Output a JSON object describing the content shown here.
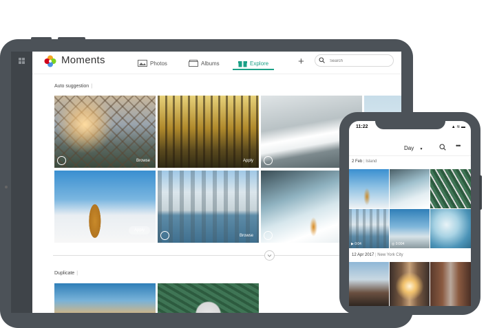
{
  "app": {
    "title": "Moments"
  },
  "nav": {
    "photos": "Photos",
    "albums": "Albums",
    "explore": "Explore"
  },
  "search": {
    "placeholder": "Search"
  },
  "sections": {
    "auto_suggestion": "Auto suggestion",
    "duplicate": "Duplicate"
  },
  "photo_actions": {
    "browse": "Browse",
    "apply": "Apply"
  },
  "phone": {
    "time": "11:22",
    "status": "▲ ≋ ▬",
    "view": "Day",
    "dates": [
      {
        "date": "2 Feb",
        "place": "Island"
      },
      {
        "date": "12 Apr 2017",
        "place": "New York City"
      }
    ],
    "durations": [
      "0:04",
      "0:004"
    ]
  },
  "colors": {
    "accent": "#1aa086",
    "device_frame": "#4c5258"
  }
}
